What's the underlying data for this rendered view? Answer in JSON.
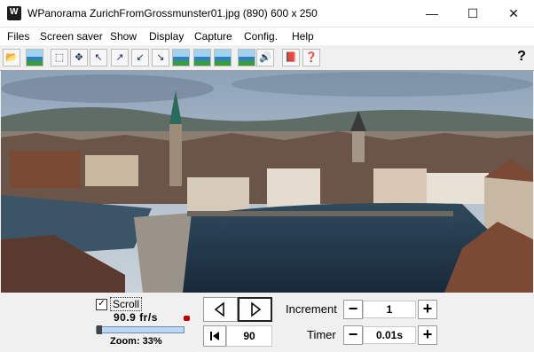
{
  "window": {
    "title": "WPanorama  ZurichFromGrossmunster01.jpg   (890) 600 x 250",
    "minimize": "—",
    "maximize": "☐",
    "close": "✕"
  },
  "menu": [
    {
      "label": "Files"
    },
    {
      "label": "Screen saver"
    },
    {
      "label": "Show"
    },
    {
      "label": "Display"
    },
    {
      "label": "Capture"
    },
    {
      "label": "Config."
    },
    {
      "label": "Help"
    }
  ],
  "toolbar": {
    "help_glyph": "?"
  },
  "controls": {
    "scroll_checked": true,
    "scroll_label": "Scroll",
    "fps": "90.9 fr/s",
    "zoom": "Zoom: 33%",
    "zoom_fraction": 0.33,
    "slider_position": 0.0,
    "step_value": "90",
    "increment_label": "Increment",
    "increment_value": "1",
    "timer_label": "Timer",
    "timer_value": "0.01s",
    "minus": "−",
    "plus": "+"
  },
  "colors": {
    "sky": "#9fb3c6",
    "river": "#223848",
    "roof": "#7a4a35"
  }
}
